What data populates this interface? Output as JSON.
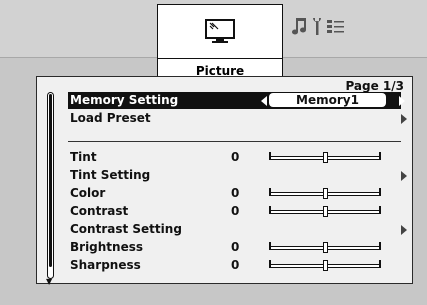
{
  "tabs": {
    "picture_label": "Picture",
    "picture_icon": "monitor-icon",
    "other_icons": [
      "music-note-icon",
      "tools-icon",
      "settings-list-icon"
    ]
  },
  "panel": {
    "page_indicator": "Page 1/3"
  },
  "menu": {
    "memory_setting": {
      "label": "Memory Setting",
      "value": "Memory1"
    },
    "load_preset": {
      "label": "Load Preset"
    },
    "tint": {
      "label": "Tint",
      "value": "0",
      "level": 0.5
    },
    "tint_setting": {
      "label": "Tint Setting"
    },
    "color": {
      "label": "Color",
      "value": "0",
      "level": 0.5
    },
    "contrast": {
      "label": "Contrast",
      "value": "0",
      "level": 0.5
    },
    "contrast_setting": {
      "label": "Contrast Setting"
    },
    "brightness": {
      "label": "Brightness",
      "value": "0",
      "level": 0.5
    },
    "sharpness": {
      "label": "Sharpness",
      "value": "0",
      "level": 0.5
    }
  },
  "colors": {
    "background": "#c7c7c7",
    "panel": "#f0f0f0",
    "selected": "#111111"
  }
}
